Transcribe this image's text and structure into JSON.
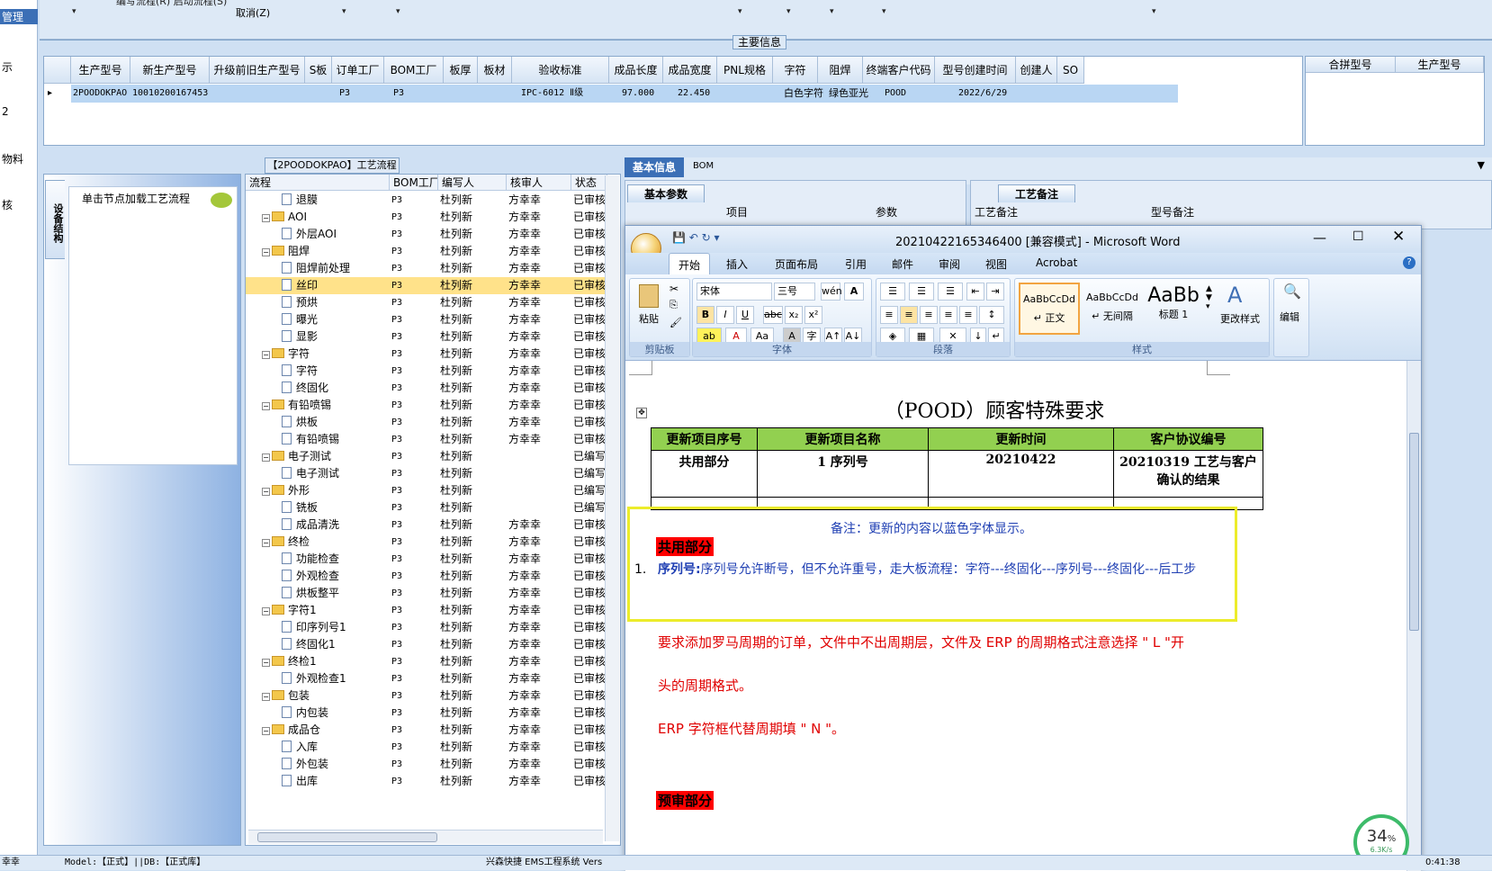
{
  "left_strip": {
    "items": [
      "管理",
      "示",
      "2",
      "物料",
      "核"
    ],
    "bottom": "幸幸"
  },
  "top_bar": {
    "line1": "编写流程(R)  启动流程(S)",
    "cancel": "取消(Z)"
  },
  "main_info": {
    "title": "主要信息",
    "columns": [
      "生产型号",
      "新生产型号",
      "升级前旧生产型号",
      "S板",
      "订单工厂",
      "BOM工厂",
      "板厚",
      "板材",
      "验收标准",
      "成品长度",
      "成品宽度",
      "PNL规格",
      "字符",
      "阻焊",
      "终端客户代码",
      "型号创建时间",
      "创建人",
      "SO"
    ],
    "row": {
      "prod_model": "2POODOKPAO",
      "new_model": "10010200167453",
      "order_factory": "P3",
      "bom_factory": "P3",
      "standard": "IPC-6012 Ⅱ级",
      "length": "97.000",
      "width": "22.450",
      "char": "白色字符",
      "mask": "绿色亚光",
      "customer": "POOD",
      "created": "2022/6/29"
    }
  },
  "merge_grid": {
    "columns": [
      "合拼型号",
      "生产型号"
    ]
  },
  "flow": {
    "title": "【2POODOKPAO】工艺流程",
    "side_tab": "设备结构",
    "load_hint": "单击节点加载工艺流程",
    "columns": [
      "流程",
      "BOM工厂",
      "编写人",
      "核审人",
      "状态"
    ],
    "rows": [
      {
        "lvl": 2,
        "name": "退膜",
        "f": "P3",
        "w": "杜列新",
        "r": "方幸幸",
        "s": "已审核"
      },
      {
        "lvl": 1,
        "name": "AOI",
        "f": "P3",
        "w": "杜列新",
        "r": "方幸幸",
        "s": "已审核"
      },
      {
        "lvl": 2,
        "name": "外层AOI",
        "f": "P3",
        "w": "杜列新",
        "r": "方幸幸",
        "s": "已审核"
      },
      {
        "lvl": 1,
        "name": "阻焊",
        "f": "P3",
        "w": "杜列新",
        "r": "方幸幸",
        "s": "已审核"
      },
      {
        "lvl": 2,
        "name": "阻焊前处理",
        "f": "P3",
        "w": "杜列新",
        "r": "方幸幸",
        "s": "已审核"
      },
      {
        "lvl": 2,
        "name": "丝印",
        "f": "P3",
        "w": "杜列新",
        "r": "方幸幸",
        "s": "已审核",
        "sel": true
      },
      {
        "lvl": 2,
        "name": "预烘",
        "f": "P3",
        "w": "杜列新",
        "r": "方幸幸",
        "s": "已审核"
      },
      {
        "lvl": 2,
        "name": "曝光",
        "f": "P3",
        "w": "杜列新",
        "r": "方幸幸",
        "s": "已审核"
      },
      {
        "lvl": 2,
        "name": "显影",
        "f": "P3",
        "w": "杜列新",
        "r": "方幸幸",
        "s": "已审核"
      },
      {
        "lvl": 1,
        "name": "字符",
        "f": "P3",
        "w": "杜列新",
        "r": "方幸幸",
        "s": "已审核"
      },
      {
        "lvl": 2,
        "name": "字符",
        "f": "P3",
        "w": "杜列新",
        "r": "方幸幸",
        "s": "已审核"
      },
      {
        "lvl": 2,
        "name": "终固化",
        "f": "P3",
        "w": "杜列新",
        "r": "方幸幸",
        "s": "已审核"
      },
      {
        "lvl": 1,
        "name": "有铅喷锡",
        "f": "P3",
        "w": "杜列新",
        "r": "方幸幸",
        "s": "已审核"
      },
      {
        "lvl": 2,
        "name": "烘板",
        "f": "P3",
        "w": "杜列新",
        "r": "方幸幸",
        "s": "已审核"
      },
      {
        "lvl": 2,
        "name": "有铅喷锡",
        "f": "P3",
        "w": "杜列新",
        "r": "方幸幸",
        "s": "已审核"
      },
      {
        "lvl": 1,
        "name": "电子测试",
        "f": "P3",
        "w": "杜列新",
        "r": "",
        "s": "已编写"
      },
      {
        "lvl": 2,
        "name": "电子测试",
        "f": "P3",
        "w": "杜列新",
        "r": "",
        "s": "已编写"
      },
      {
        "lvl": 1,
        "name": "外形",
        "f": "P3",
        "w": "杜列新",
        "r": "",
        "s": "已编写"
      },
      {
        "lvl": 2,
        "name": "铣板",
        "f": "P3",
        "w": "杜列新",
        "r": "",
        "s": "已编写"
      },
      {
        "lvl": 2,
        "name": "成品清洗",
        "f": "P3",
        "w": "杜列新",
        "r": "方幸幸",
        "s": "已审核"
      },
      {
        "lvl": 1,
        "name": "终检",
        "f": "P3",
        "w": "杜列新",
        "r": "方幸幸",
        "s": "已审核"
      },
      {
        "lvl": 2,
        "name": "功能检查",
        "f": "P3",
        "w": "杜列新",
        "r": "方幸幸",
        "s": "已审核"
      },
      {
        "lvl": 2,
        "name": "外观检查",
        "f": "P3",
        "w": "杜列新",
        "r": "方幸幸",
        "s": "已审核"
      },
      {
        "lvl": 2,
        "name": "烘板整平",
        "f": "P3",
        "w": "杜列新",
        "r": "方幸幸",
        "s": "已审核"
      },
      {
        "lvl": 1,
        "name": "字符1",
        "f": "P3",
        "w": "杜列新",
        "r": "方幸幸",
        "s": "已审核"
      },
      {
        "lvl": 2,
        "name": "印序列号1",
        "f": "P3",
        "w": "杜列新",
        "r": "方幸幸",
        "s": "已审核"
      },
      {
        "lvl": 2,
        "name": "终固化1",
        "f": "P3",
        "w": "杜列新",
        "r": "方幸幸",
        "s": "已审核"
      },
      {
        "lvl": 1,
        "name": "终检1",
        "f": "P3",
        "w": "杜列新",
        "r": "方幸幸",
        "s": "已审核"
      },
      {
        "lvl": 2,
        "name": "外观检查1",
        "f": "P3",
        "w": "杜列新",
        "r": "方幸幸",
        "s": "已审核"
      },
      {
        "lvl": 1,
        "name": "包装",
        "f": "P3",
        "w": "杜列新",
        "r": "方幸幸",
        "s": "已审核"
      },
      {
        "lvl": 2,
        "name": "内包装",
        "f": "P3",
        "w": "杜列新",
        "r": "方幸幸",
        "s": "已审核"
      },
      {
        "lvl": 1,
        "name": "成品仓",
        "f": "P3",
        "w": "杜列新",
        "r": "方幸幸",
        "s": "已审核"
      },
      {
        "lvl": 2,
        "name": "入库",
        "f": "P3",
        "w": "杜列新",
        "r": "方幸幸",
        "s": "已审核"
      },
      {
        "lvl": 2,
        "name": "外包装",
        "f": "P3",
        "w": "杜列新",
        "r": "方幸幸",
        "s": "已审核"
      },
      {
        "lvl": 2,
        "name": "出库",
        "f": "P3",
        "w": "杜列新",
        "r": "方幸幸",
        "s": "已审核"
      }
    ]
  },
  "right": {
    "tab_basic": "基本信息",
    "tab_bom": "BOM",
    "basic_params": "基本参数",
    "col_item": "项目",
    "col_param": "参数",
    "proc_note": "工艺备注",
    "proc_note_col": "工艺备注",
    "model_note_col": "型号备注"
  },
  "word": {
    "title": "20210422165346400 [兼容模式] - Microsoft Word",
    "tabs": [
      "开始",
      "插入",
      "页面布局",
      "引用",
      "邮件",
      "审阅",
      "视图",
      "Acrobat"
    ],
    "font_name": "宋体",
    "font_size": "三号",
    "groups": {
      "clipboard": "剪贴板",
      "font": "字体",
      "paragraph": "段落",
      "styles": "样式"
    },
    "paste": "粘贴",
    "change_styles": "更改样式",
    "edit": "编辑",
    "style_items": [
      {
        "sample": "AaBbCcDd",
        "name": "↵ 正文"
      },
      {
        "sample": "AaBbCcDd",
        "name": "↵ 无间隔"
      },
      {
        "sample": "AaBb",
        "name": "标题 1"
      }
    ],
    "doc": {
      "title": "（POOD）顾客特殊要求",
      "table_head": [
        "更新项目序号",
        "更新项目名称",
        "更新时间",
        "客户协议编号"
      ],
      "table_row": [
        "共用部分",
        "1 序列号",
        "20210422",
        "20210319 工艺与客户确认的结果"
      ],
      "note": "备注：更新的内容以蓝色字体显示。",
      "section1": "共用部分",
      "item1_num": "1.",
      "item1_label": "序列号:",
      "item1_text": "序列号允许断号，但不允许重号，走大板流程：字符---终固化---序列号---终固化---后工步",
      "red1": "要求添加罗马周期的订单，文件中不出周期层，文件及 ERP 的周期格式注意选择 \" L \"开",
      "red2": "头的周期格式。",
      "red3": "ERP 字符框代替周期填 \" N \"。",
      "section2": "预审部分"
    }
  },
  "status_bar": {
    "model": "Model:【正式】||DB:【正式库】",
    "app": "兴森快捷 EMS工程系统 Vers",
    "time": "0:41:38"
  },
  "net": {
    "percent": "34",
    "unit": "%",
    "speed": "6.3K/s"
  }
}
